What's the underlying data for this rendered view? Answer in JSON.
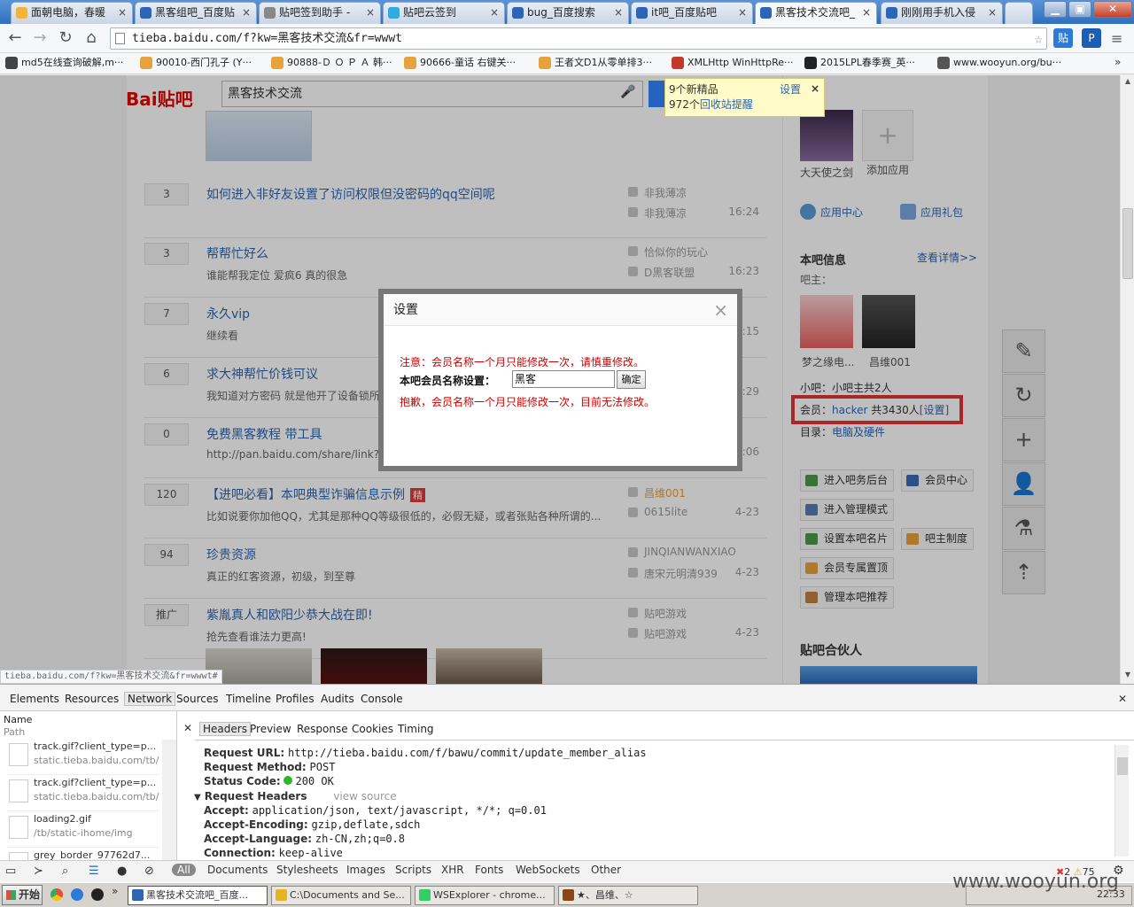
{
  "browser": {
    "tabs": [
      {
        "label": "面朝电脑，春暖",
        "color": "#f0b43c"
      },
      {
        "label": "黑客组吧_百度贴",
        "color": "#2d64b3"
      },
      {
        "label": "贴吧签到助手 -",
        "color": "#888888"
      },
      {
        "label": "贴吧云签到",
        "color": "#33aadd"
      },
      {
        "label": "bug_百度搜索",
        "color": "#2d64b3"
      },
      {
        "label": "it吧_百度贴吧",
        "color": "#2d64b3"
      },
      {
        "label": "黑客技术交流吧_",
        "color": "#2d64b3"
      },
      {
        "label": "刚刚用手机入侵",
        "color": "#2d64b3"
      }
    ],
    "address": "tieba.baidu.com/f?kw=黑客技术交流&fr=wwwt",
    "ext_buttons": [
      "贴",
      "P"
    ],
    "bookmarks": [
      {
        "label": "md5在线查询破解,m···",
        "color": "#444444"
      },
      {
        "label": "90010-西门孔子 (Y···",
        "color": "#e6a23c"
      },
      {
        "label": "90888-Ｄ Ｏ Ｐ Ａ  韩···",
        "color": "#e6a23c"
      },
      {
        "label": "90666-童话 右键关···",
        "color": "#e6a23c"
      },
      {
        "label": "王者文D1从零单排3···",
        "color": "#e6a23c"
      },
      {
        "label": "XMLHttp WinHttpRe···",
        "color": "#c0392b"
      },
      {
        "label": "2015LPL春季赛_英···",
        "color": "#222222"
      },
      {
        "label": "www.wooyun.org/bu···",
        "color": "#555555"
      }
    ]
  },
  "page": {
    "logo": "Bai贴吧",
    "search_value": "黑客技术交流",
    "notice": {
      "line1": "9个新精品",
      "settings": "设置",
      "line2_pre": "972个",
      "line2_link": "回收站提醒",
      "close": "×"
    },
    "posts": [
      {
        "count": "3",
        "title": "如何进入非好友设置了访问权限但没密码的qq空间呢",
        "desc": "",
        "author": "非我薄凉",
        "last": "非我薄凉",
        "time": "16:24"
      },
      {
        "count": "3",
        "title": "帮帮忙好么",
        "desc": "谁能帮我定位 爱疯6 真的很急",
        "author": "恰似你的玩心",
        "last": "D黑客联盟",
        "time": "16:23"
      },
      {
        "count": "7",
        "title": "永久vip",
        "desc": "继续看",
        "author": "",
        "last": "",
        "time": "09:15"
      },
      {
        "count": "6",
        "title": "求大神帮忙价钱可议",
        "desc": "我知道对方密码 就是他开了设备锁所以",
        "author": "",
        "last": "",
        "time": "07:29"
      },
      {
        "count": "0",
        "title": "免费黑客教程 带工具",
        "desc": "http://pan.baidu.com/share/link?shar",
        "author": "",
        "last": "",
        "time": "05:06"
      },
      {
        "count": "120",
        "title": "【进吧必看】本吧典型诈骗信息示例",
        "badge": "精",
        "desc": "比如说要你加他QQ，尤其是那种QQ等级很低的，必假无疑，或者张贴各种所谓的...",
        "author": "昌维001",
        "last": "0615lite",
        "time": "4-23"
      },
      {
        "count": "94",
        "title": "珍贵资源",
        "desc": "真正的红客资源，初级，到至尊",
        "author": "JINQIANWANXIAO",
        "last": "唐宋元明清939",
        "time": "4-23"
      },
      {
        "count": "推广",
        "title": "紫胤真人和欧阳少恭大战在即!",
        "desc": "抢先查看谁法力更高!",
        "author": "贴吧游戏",
        "last": "贴吧游戏",
        "time": "4-23"
      }
    ],
    "side": {
      "app1": "大天使之剑",
      "app2": "添加应用",
      "app_center": "应用中心",
      "app_gift": "应用礼包",
      "info_title": "本吧信息",
      "info_more": "查看详情>>",
      "owner_label": "吧主：",
      "owner1": "梦之缘电...",
      "owner2": "昌维001",
      "small_owner": "小吧：小吧主共2人",
      "member_label": "会员：",
      "member_name": "hacker",
      "member_count": "共3430人",
      "member_setting": "[设置]",
      "dir_label": "目录：",
      "dir_value": "电脑及硬件",
      "buttons": [
        "进入吧务后台",
        "会员中心",
        "进入管理模式",
        "设置本吧名片",
        "吧主制度",
        "会员专属置顶",
        "管理本吧推荐"
      ],
      "partner": "贴吧合伙人"
    },
    "dialog": {
      "title": "设置",
      "close": "×",
      "note": "注意：会员名称一个月只能修改一次，请慎重修改。",
      "field_label": "本吧会员名称设置：",
      "field_value": "黑客",
      "confirm": "确定",
      "error": "抱歉，会员名称一个月只能修改一次，目前无法修改。"
    },
    "status_url": "tieba.baidu.com/f?kw=黑客技术交流&fr=wwwt#"
  },
  "devtools": {
    "tabs": [
      "Elements",
      "Resources",
      "Network",
      "Sources",
      "Timeline",
      "Profiles",
      "Audits",
      "Console"
    ],
    "selected_tab": "Network",
    "col_name": "Name",
    "col_path": "Path",
    "requests": [
      {
        "name": "track.gif?client_type=p...",
        "path": "static.tieba.baidu.com/tb/"
      },
      {
        "name": "track.gif?client_type=p...",
        "path": "static.tieba.baidu.com/tb/"
      },
      {
        "name": "loading2.gif",
        "path": "/tb/static-ihome/img"
      },
      {
        "name": "grey_border_97762d7...",
        "path": ""
      }
    ],
    "detail_tabs": [
      "Headers",
      "Preview",
      "Response",
      "Cookies",
      "Timing"
    ],
    "headers": [
      {
        "k": "Request URL:",
        "v": "http://tieba.baidu.com/f/bawu/commit/update_member_alias"
      },
      {
        "k": "Request Method:",
        "v": "POST"
      },
      {
        "k": "Status Code:",
        "v": "200 OK"
      },
      {
        "k": "Request Headers",
        "v": "view source"
      },
      {
        "k": "Accept:",
        "v": "application/json, text/javascript, */*; q=0.01"
      },
      {
        "k": "Accept-Encoding:",
        "v": "gzip,deflate,sdch"
      },
      {
        "k": "Accept-Language:",
        "v": "zh-CN,zh;q=0.8"
      },
      {
        "k": "Connection:",
        "v": "keep-alive"
      }
    ],
    "filters": [
      "All",
      "Documents",
      "Stylesheets",
      "Images",
      "Scripts",
      "XHR",
      "Fonts",
      "WebSockets",
      "Other"
    ],
    "errors": "2",
    "warnings": "75"
  },
  "taskbar": {
    "start": "开始",
    "tasks": [
      {
        "label": "黑客技术交流吧_百度...",
        "color": "#2d64b3"
      },
      {
        "label": "C:\\Documents and Se...",
        "color": "#e6b422"
      },
      {
        "label": "WSExplorer - chrome...",
        "color": "#3c6"
      },
      {
        "label": "★、昌维、☆",
        "color": "#8b4513"
      }
    ],
    "clock": "22:33",
    "watermark": "www.wooyun.org"
  }
}
